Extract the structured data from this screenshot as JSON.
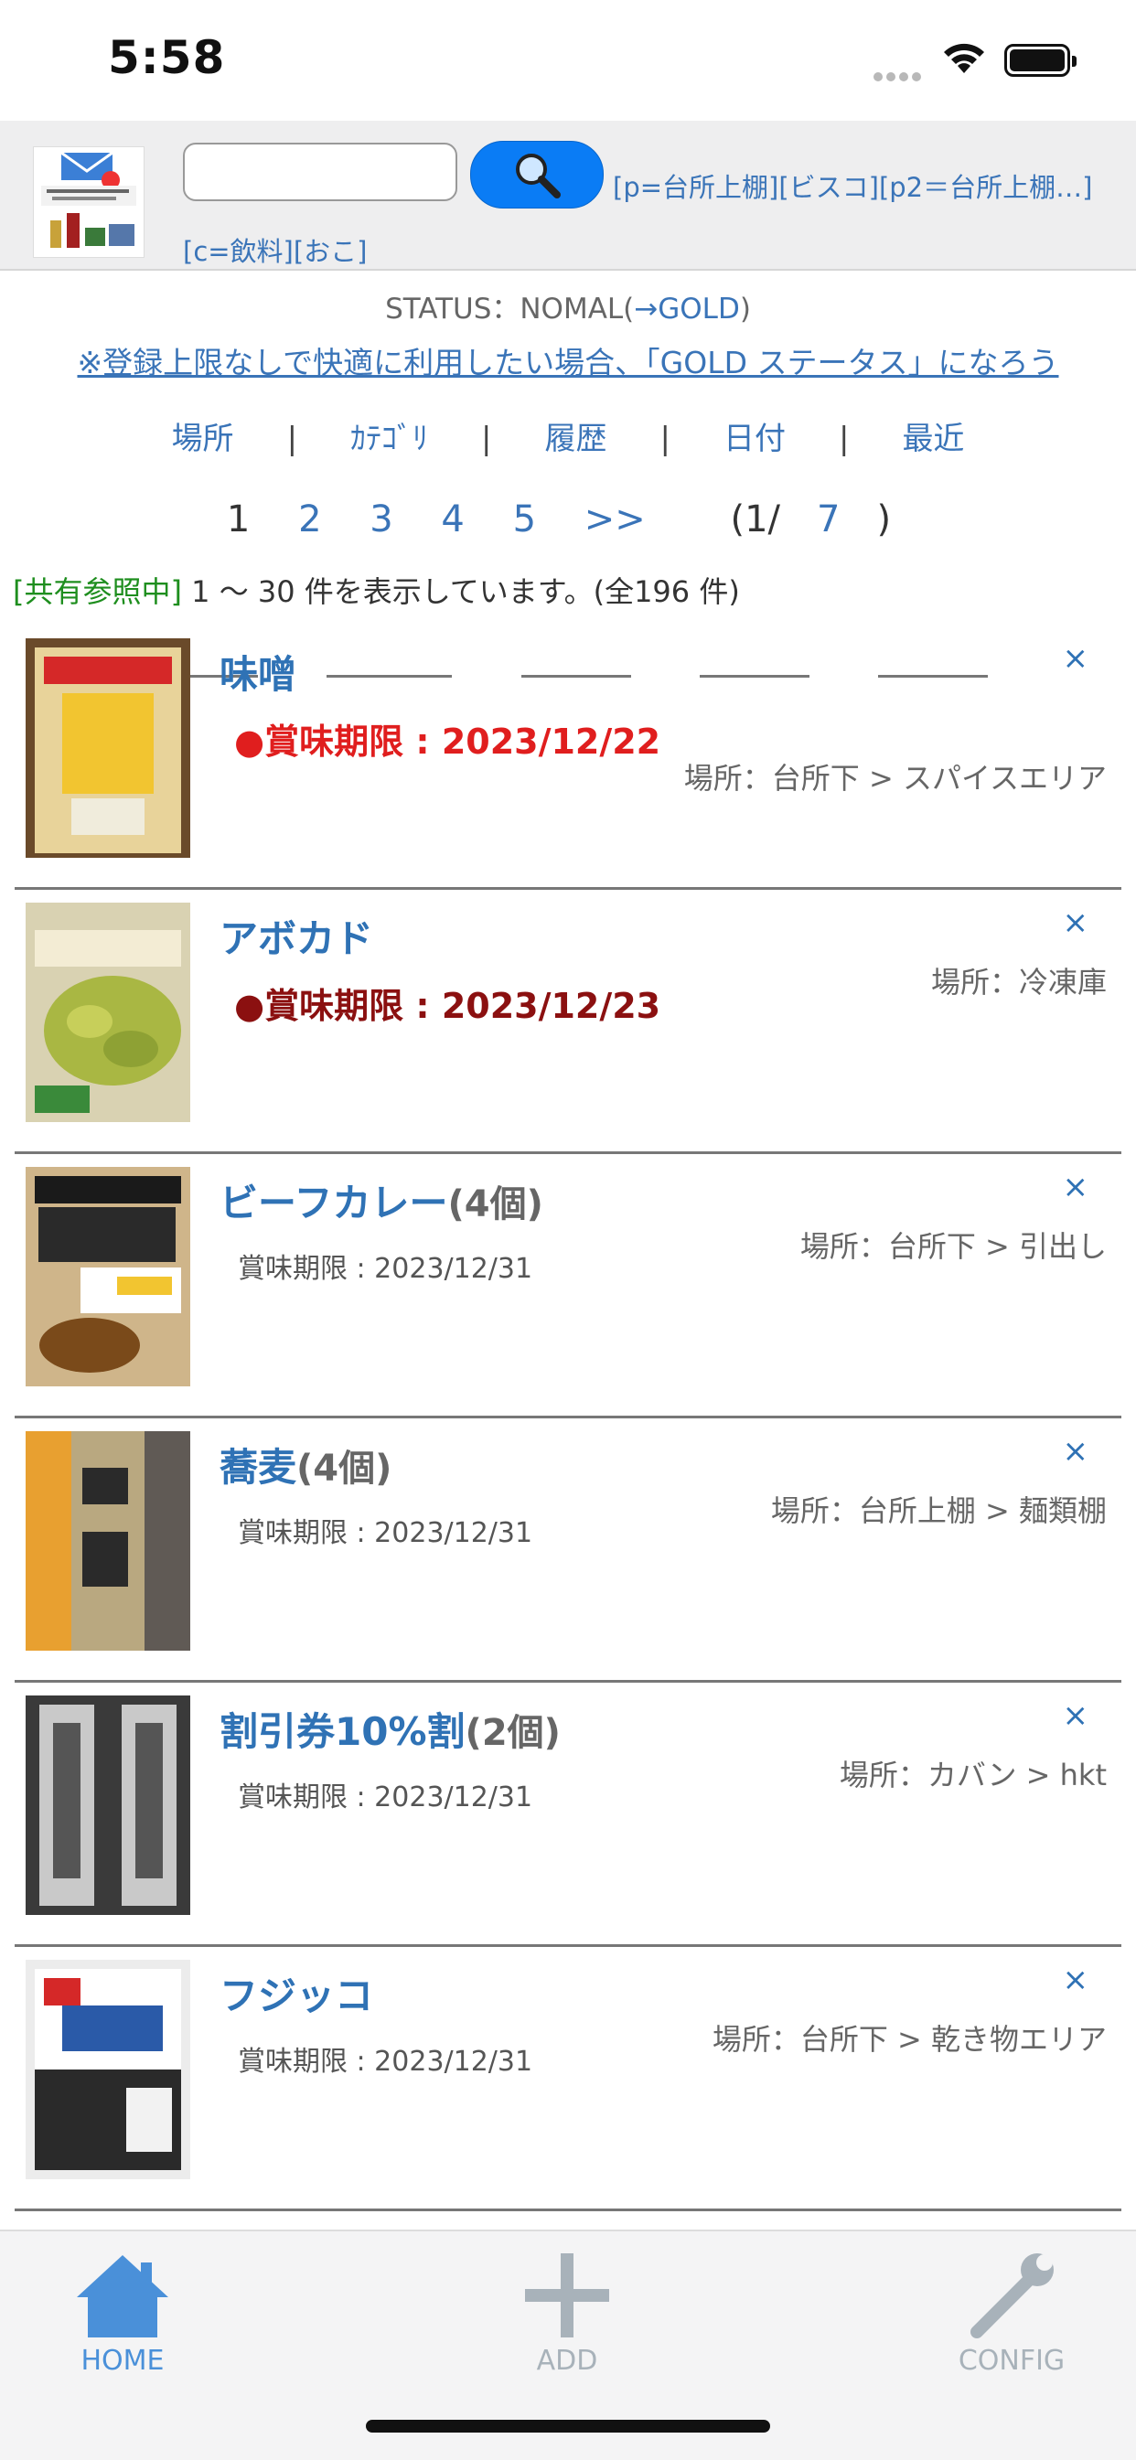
{
  "status_bar": {
    "time": "5:58"
  },
  "header": {
    "search_placeholder": "",
    "quick_links": "[p=台所上棚][ビスコ][p2＝台所上棚…][c=飲料][おこ]"
  },
  "status": {
    "prefix": "STATUS：NOMAL(",
    "link": "→GOLD",
    "suffix": ")"
  },
  "gold_promo": "※登録上限なしで快適に利用したい場合、「GOLD ステータス」になろう",
  "sort_nav": [
    "場所",
    "ｶﾃｺﾞﾘ",
    "履歴",
    "日付",
    "最近"
  ],
  "pager": {
    "current": "1",
    "pages": [
      "2",
      "3",
      "4",
      "5"
    ],
    "next": ">>",
    "total_prefix": "(1/",
    "total_pages": "7",
    "total_suffix": ")"
  },
  "count": {
    "shared": "[共有参照中]",
    "text": " 1 〜 30 件を表示しています。(全196 件)"
  },
  "items": [
    {
      "name": "味噌",
      "qty": "",
      "expiry": "●賞味期限 : 2023/12/22",
      "expiry_state": "urgent",
      "location": "場所：台所下 > スパイスエリア",
      "close": "×"
    },
    {
      "name": "アボカド",
      "qty": "",
      "expiry": "●賞味期限 : 2023/12/23",
      "expiry_state": "soon",
      "location": "場所：冷凍庫",
      "close": "×"
    },
    {
      "name": "ビーフカレー",
      "qty": "(4個)",
      "expiry": "賞味期限 : 2023/12/31",
      "expiry_state": "normal",
      "location": "場所：台所下 > 引出し",
      "close": "×"
    },
    {
      "name": "蕎麦",
      "qty": "(4個)",
      "expiry": "賞味期限 : 2023/12/31",
      "expiry_state": "normal",
      "location": "場所：台所上棚 > 麺類棚",
      "close": "×"
    },
    {
      "name": "割引券10%割",
      "qty": "(2個)",
      "expiry": "賞味期限 : 2023/12/31",
      "expiry_state": "normal",
      "location": "場所：カバン > hkt",
      "close": "×"
    },
    {
      "name": "フジッコ",
      "qty": "",
      "expiry": "賞味期限 : 2023/12/31",
      "expiry_state": "normal",
      "location": "場所：台所下 > 乾き物エリア",
      "close": "×"
    }
  ],
  "tabbar": {
    "home": "HOME",
    "add": "ADD",
    "config": "CONFIG"
  },
  "colors": {
    "link": "#2f72b5",
    "urgent": "#e01e1e",
    "soon": "#8b1010",
    "shared": "#1e8e1e",
    "search_button": "#0a7cf5"
  },
  "icons": {
    "search": "magnifier-icon",
    "home": "house-icon",
    "add": "plus-icon",
    "config": "wrench-icon"
  }
}
